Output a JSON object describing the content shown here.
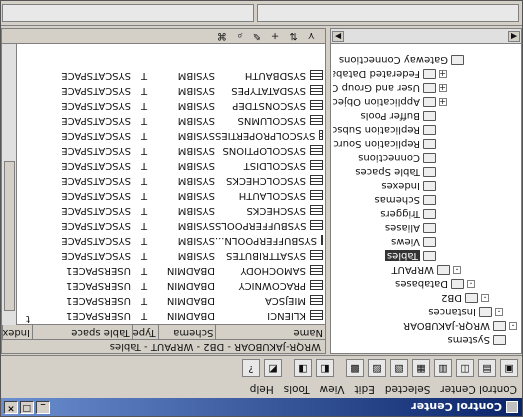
{
  "window": {
    "title": "Control Center"
  },
  "menu": [
    "Control Center",
    "Selected",
    "Edit",
    "View",
    "Tools",
    "Help"
  ],
  "tree": {
    "items": [
      {
        "label": "Systems",
        "depth": 0,
        "exp": ""
      },
      {
        "label": "WRQR-JAKUBOAR",
        "depth": 0,
        "exp": "-"
      },
      {
        "label": "Instances",
        "depth": 1,
        "exp": "-"
      },
      {
        "label": "DB2",
        "depth": 2,
        "exp": "-"
      },
      {
        "label": "Databases",
        "depth": 3,
        "exp": "-"
      },
      {
        "label": "WRPAUT",
        "depth": 4,
        "exp": "-"
      },
      {
        "label": "Tables",
        "depth": 5,
        "exp": "",
        "selected": true
      },
      {
        "label": "Views",
        "depth": 5,
        "exp": ""
      },
      {
        "label": "Aliases",
        "depth": 5,
        "exp": ""
      },
      {
        "label": "Triggers",
        "depth": 5,
        "exp": ""
      },
      {
        "label": "Schemas",
        "depth": 5,
        "exp": ""
      },
      {
        "label": "Indexes",
        "depth": 5,
        "exp": ""
      },
      {
        "label": "Table Spaces",
        "depth": 5,
        "exp": ""
      },
      {
        "label": "Connections",
        "depth": 5,
        "exp": ""
      },
      {
        "label": "Replication Sources",
        "depth": 5,
        "exp": ""
      },
      {
        "label": "Replication Subscriptions",
        "depth": 5,
        "exp": ""
      },
      {
        "label": "Buffer Pools",
        "depth": 5,
        "exp": ""
      },
      {
        "label": "Application Objects",
        "depth": 5,
        "exp": "+"
      },
      {
        "label": "User and Group Objects",
        "depth": 5,
        "exp": "+"
      },
      {
        "label": "Federated Database Objects",
        "depth": 5,
        "exp": "+"
      },
      {
        "label": "Gateway Connections",
        "depth": 3,
        "exp": ""
      }
    ]
  },
  "right": {
    "header": "WRQR-JAKUBOAR - DB2 - WRPAUT - Tables",
    "columns": [
      "Name",
      "Schema",
      "Type",
      "Table space",
      "Index t"
    ],
    "rows": [
      [
        "KLIENCI",
        "DBADMIN",
        "T",
        "USERSPACE1"
      ],
      [
        "MIEJSCA",
        "DBADMIN",
        "T",
        "USERSPACE1"
      ],
      [
        "PRACOWNICY",
        "DBADMIN",
        "T",
        "USERSPACE1"
      ],
      [
        "SAMOCHODY",
        "DBADMIN",
        "T",
        "USERSPACE1"
      ],
      [
        "SYSATTRIBUTES",
        "SYSIBM",
        "T",
        "SYSCATSPACE"
      ],
      [
        "SYSBUFFERPOOLN...",
        "SYSIBM",
        "T",
        "SYSCATSPACE"
      ],
      [
        "SYSBUFFERPOOLS",
        "SYSIBM",
        "T",
        "SYSCATSPACE"
      ],
      [
        "SYSCHECKS",
        "SYSIBM",
        "T",
        "SYSCATSPACE"
      ],
      [
        "SYSCOLAUTH",
        "SYSIBM",
        "T",
        "SYSCATSPACE"
      ],
      [
        "SYSCOLCHECKS",
        "SYSIBM",
        "T",
        "SYSCATSPACE"
      ],
      [
        "SYSCOLDIST",
        "SYSIBM",
        "T",
        "SYSCATSPACE"
      ],
      [
        "SYSCOLOPTIONS",
        "SYSIBM",
        "T",
        "SYSCATSPACE"
      ],
      [
        "SYSCOLPROPERTIES",
        "SYSIBM",
        "T",
        "SYSCATSPACE"
      ],
      [
        "SYSCOLUMNS",
        "SYSIBM",
        "T",
        "SYSCATSPACE"
      ],
      [
        "SYSCONSTDEP",
        "SYSIBM",
        "T",
        "SYSCATSPACE"
      ],
      [
        "SYSDATATYPES",
        "SYSIBM",
        "T",
        "SYSCATSPACE"
      ],
      [
        "SYSDBAUTH",
        "SYSIBM",
        "T",
        "SYSCATSPACE"
      ]
    ]
  },
  "colors": {
    "title_bar": "#0a246a",
    "chrome": "#d4d0c8"
  }
}
